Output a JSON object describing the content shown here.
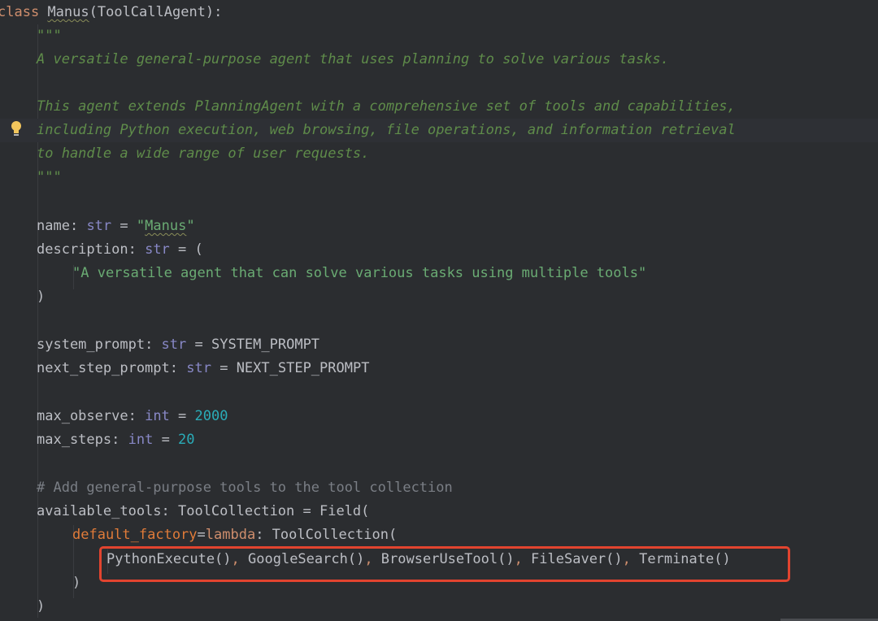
{
  "code": {
    "l1": {
      "kw": "class",
      "name": "Manus",
      "rest": "(ToolCallAgent):"
    },
    "l2": {
      "doc": "\"\"\""
    },
    "l3": {
      "doc": "A versatile general-purpose agent that uses planning to solve various tasks."
    },
    "l4": {
      "doc": "This agent extends PlanningAgent with a comprehensive set of tools and capabilities,"
    },
    "l5": {
      "doc": "including Python execution, web browsing, file operations, and information retrieval"
    },
    "l6": {
      "doc": "to handle a wide range of user requests."
    },
    "l7": {
      "doc": "\"\"\""
    },
    "l8": {
      "name": "name",
      "colon": ": ",
      "type": "str",
      "eq": " = ",
      "q1": "\"",
      "strval": "Manus",
      "q2": "\""
    },
    "l9": {
      "name": "description",
      "colon": ": ",
      "type": "str",
      "eq": " = ("
    },
    "l10": {
      "str": "\"A versatile agent that can solve various tasks using multiple tools\""
    },
    "l11": {
      "text": ")"
    },
    "l12": {
      "name": "system_prompt",
      "colon": ": ",
      "type": "str",
      "eq": " = ",
      "value": "SYSTEM_PROMPT"
    },
    "l13": {
      "name": "next_step_prompt",
      "colon": ": ",
      "type": "str",
      "eq": " = ",
      "value": "NEXT_STEP_PROMPT"
    },
    "l14": {
      "name": "max_observe",
      "colon": ": ",
      "type": "int",
      "eq": " = ",
      "num": "2000"
    },
    "l15": {
      "name": "max_steps",
      "colon": ": ",
      "type": "int",
      "eq": " = ",
      "num": "20"
    },
    "l16": {
      "comment": "# Add general-purpose tools to the tool collection"
    },
    "l17": {
      "text": "available_tools: ToolCollection = Field("
    },
    "l18": {
      "param": "default_factory",
      "eq": "=",
      "kw": "lambda",
      "rest": ": ToolCollection("
    },
    "l19": {
      "t1": "PythonExecute()",
      "c1": ", ",
      "t2": "GoogleSearch()",
      "c2": ", ",
      "t3": "BrowserUseTool()",
      "c3": ", ",
      "t4": "FileSaver()",
      "c4": ", ",
      "t5": "Terminate()"
    },
    "l20": {
      "text": ")"
    },
    "l21": {
      "text": ")"
    }
  },
  "colors": {
    "background": "#2b2d30",
    "keyword": "#cf8e6d",
    "docstring": "#5f8c4a",
    "string": "#6aab73",
    "number": "#2aacb8",
    "builtin_type": "#8888c6",
    "comment": "#7a7e85",
    "highlight_box": "#e2442f"
  },
  "icons": {
    "gutter": "lightbulb-icon"
  }
}
